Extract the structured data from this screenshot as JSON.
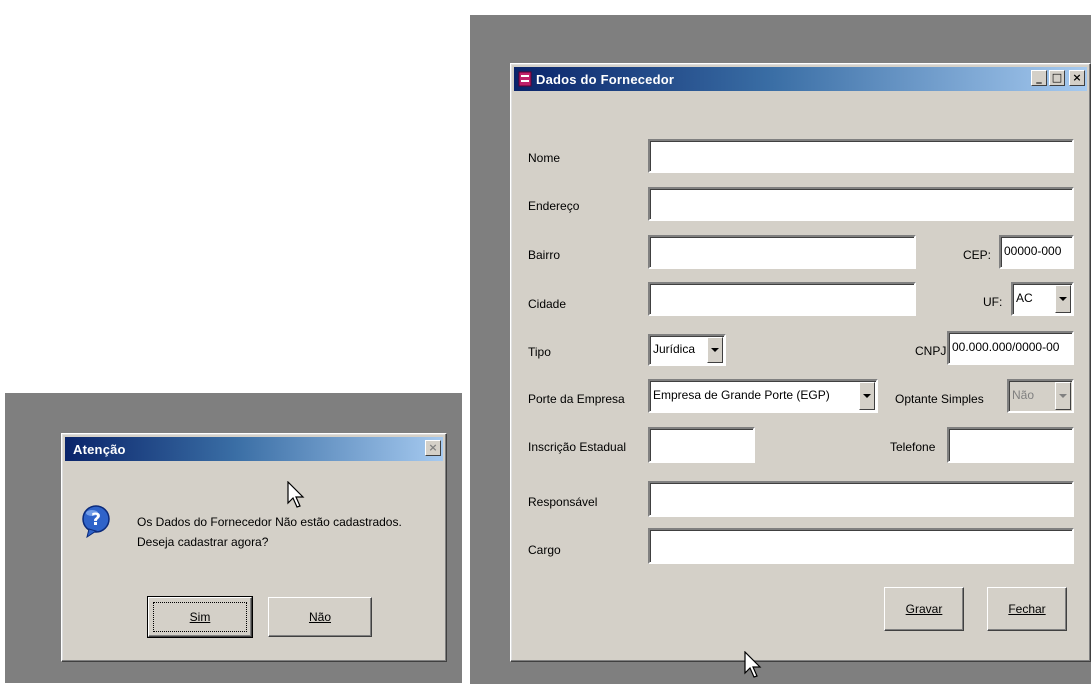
{
  "dialog": {
    "title": "Atenção",
    "close_glyph": "×",
    "icon": "question-icon",
    "message_line1": "Os Dados do Fornecedor Não estão cadastrados.",
    "message_line2": "Deseja cadastrar agora?",
    "yes_label": "Sim",
    "no_label": "Não"
  },
  "form": {
    "title": "Dados do Fornecedor",
    "window_buttons": {
      "minimize": "_",
      "maximize": "□",
      "close": "×"
    },
    "labels": {
      "nome": "Nome",
      "endereco": "Endereço",
      "bairro": "Bairro",
      "cep": "CEP:",
      "cidade": "Cidade",
      "uf": "UF:",
      "tipo": "Tipo",
      "cnpj": "CNPJ",
      "porte": "Porte da Empresa",
      "optante": "Optante Simples",
      "inscricao": "Inscrição Estadual",
      "telefone": "Telefone",
      "responsavel": "Responsável",
      "cargo": "Cargo"
    },
    "values": {
      "nome": "",
      "endereco": "",
      "bairro": "",
      "cep": "00000-000",
      "cidade": "",
      "uf": "AC",
      "tipo": "Jurídica",
      "cnpj": "00.000.000/0000-00",
      "porte": "Empresa de Grande Porte (EGP)",
      "optante": "Não",
      "inscricao": "",
      "telefone": "",
      "responsavel": "",
      "cargo": ""
    },
    "save_label": "Gravar",
    "close_label": "Fechar"
  },
  "colors": {
    "titlebar_start": "#0a246a",
    "titlebar_end": "#a6caf0",
    "window_face": "#d4d0c8",
    "backdrop": "#7f7f7f"
  }
}
